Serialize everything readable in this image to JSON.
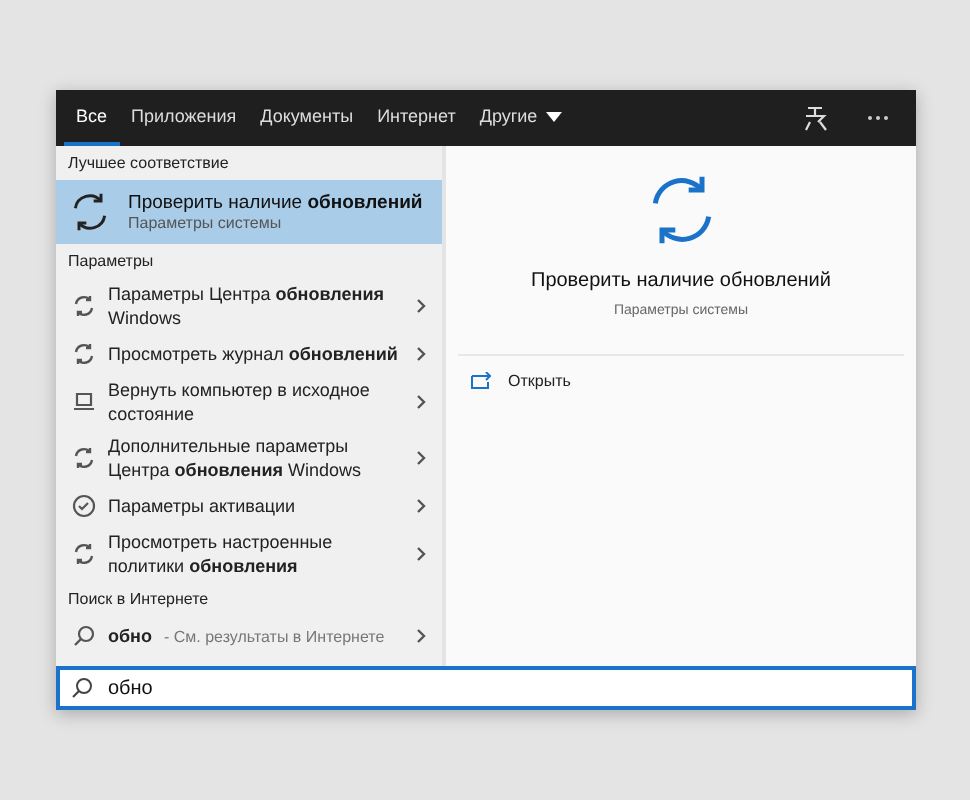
{
  "tabs": [
    {
      "label": "Все",
      "selected": true
    },
    {
      "label": "Приложения",
      "selected": false
    },
    {
      "label": "Документы",
      "selected": false
    },
    {
      "label": "Интернет",
      "selected": false
    },
    {
      "label": "Другие",
      "selected": false,
      "kind": "dropdown"
    }
  ],
  "best_match": {
    "heading": "Лучшее соответствие",
    "title": "Проверить наличие **обновлений**",
    "subtitle": "Параметры системы",
    "selected": true
  },
  "settings": {
    "heading": "Параметры",
    "items": [
      {
        "kind": "refresh",
        "text": "Параметры Центра **обновления** Windows"
      },
      {
        "kind": "refresh",
        "text": "Просмотреть журнал **обновлений**"
      },
      {
        "kind": "reset",
        "text": "Вернуть компьютер в исходное состояние"
      },
      {
        "kind": "refresh",
        "text": "Дополнительные параметры Центра **обновления** Windows"
      },
      {
        "kind": "check",
        "text": "Параметры активации"
      },
      {
        "kind": "refresh",
        "text": "Просмотреть настроенные политики **обновления**"
      }
    ]
  },
  "web": {
    "heading": "Поиск в Интернете",
    "query": "обно",
    "suffix": "- См. результаты в Интернете"
  },
  "preview": {
    "title": "Проверить наличие обновлений",
    "subtitle": "Параметры системы",
    "actions": [
      {
        "label": "Открыть"
      }
    ]
  },
  "search": {
    "value": "обно"
  }
}
